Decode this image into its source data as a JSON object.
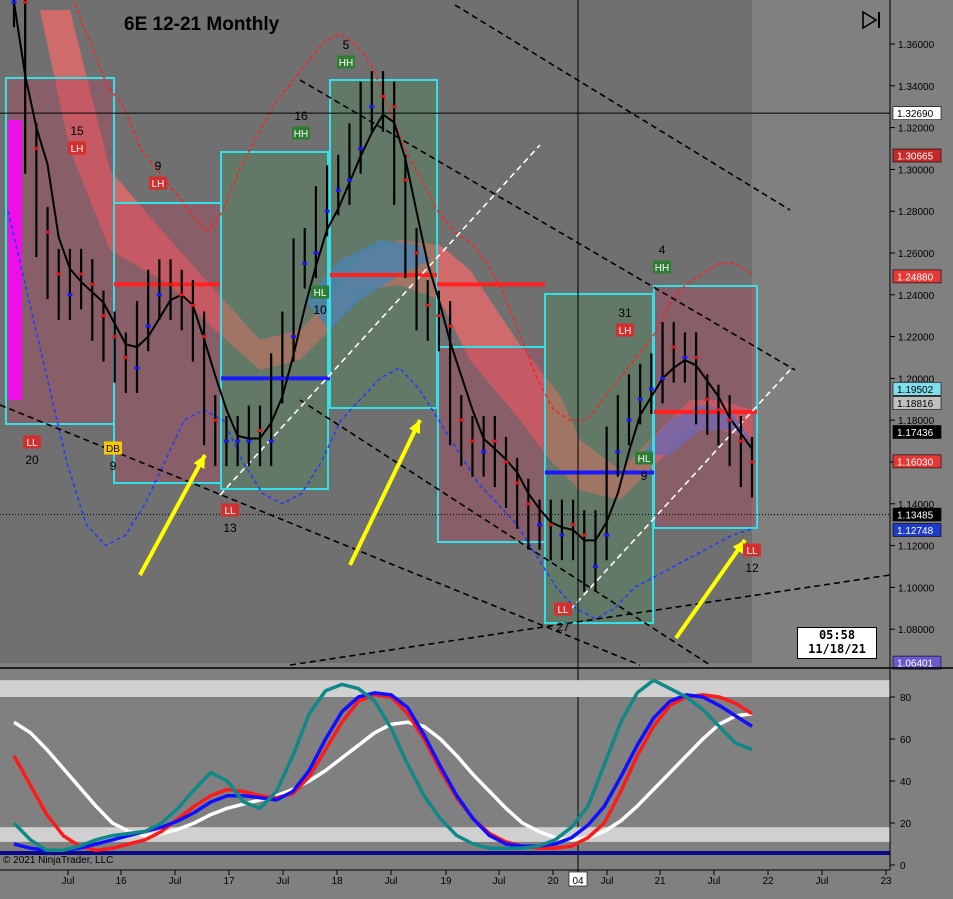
{
  "window": {
    "title": "6E 12-21 Monthly",
    "clock_time": "05:58",
    "clock_date": "11/18/21",
    "copyright": "© 2021 NinjaTrader, LLC",
    "cursor_x_label": "04"
  },
  "chart_data": [
    {
      "type": "candlestick",
      "title": "6E 12-21 Monthly",
      "ylim": [
        1.064,
        1.37
      ],
      "y_ticks": [
        1.36,
        1.34,
        1.32,
        1.3,
        1.28,
        1.26,
        1.24,
        1.22,
        1.2,
        1.18,
        1.16,
        1.14,
        1.12,
        1.1,
        1.08
      ],
      "y_tick_labels": [
        "1.36000",
        "1.34000",
        "1.32000",
        "1.30000",
        "1.28000",
        "1.26000",
        "1.24000",
        "1.22000",
        "1.20000",
        "1.18000",
        "1.16000",
        "1.14000",
        "1.12000",
        "1.10000",
        "1.08000"
      ],
      "x_tick_labels": [
        "Jul",
        "16",
        "Jul",
        "17",
        "Jul",
        "18",
        "Jul",
        "19",
        "Jul",
        "20",
        "04",
        "Jul",
        "21",
        "Jul",
        "22",
        "Jul",
        "23"
      ],
      "grid": false,
      "price_markers": [
        {
          "label": "1.32690",
          "value": 1.3269,
          "color": "#ffffff",
          "text_color": "#000000"
        },
        {
          "label": "1.30665",
          "value": 1.30665,
          "color": "#c62828",
          "text_color": "#ffffff"
        },
        {
          "label": "1.24880",
          "value": 1.2488,
          "color": "#e53935",
          "text_color": "#ffffff"
        },
        {
          "label": "1.19502",
          "value": 1.19502,
          "color": "#80deea",
          "text_color": "#000000"
        },
        {
          "label": "1.18816",
          "value": 1.18816,
          "color": "#c0c0c0",
          "text_color": "#000000"
        },
        {
          "label": "1.17436",
          "value": 1.17436,
          "color": "#000000",
          "text_color": "#ffffff"
        },
        {
          "label": "1.16030",
          "value": 1.1603,
          "color": "#e53935",
          "text_color": "#ffffff"
        },
        {
          "label": "1.13485",
          "value": 1.13485,
          "color": "#000000",
          "text_color": "#ffffff"
        },
        {
          "label": "1.12748",
          "value": 1.12748,
          "color": "#1e3cc8",
          "text_color": "#ffffff"
        },
        {
          "label": "1.06401",
          "value": 1.06401,
          "color": "#6a5acd",
          "text_color": "#ffffff"
        }
      ],
      "swing_labels": [
        {
          "tag": "LH",
          "count": "15",
          "color": "#d32f2f"
        },
        {
          "tag": "LH",
          "count": "9",
          "color": "#d32f2f"
        },
        {
          "tag": "LL",
          "count": "20",
          "color": "#d32f2f"
        },
        {
          "tag": "DB",
          "count": "9",
          "color": "#f9c800"
        },
        {
          "tag": "LL",
          "count": "13",
          "color": "#d32f2f"
        },
        {
          "tag": "HH",
          "count": "16",
          "color": "#2e7d32"
        },
        {
          "tag": "HH",
          "count": "5",
          "color": "#2e7d32"
        },
        {
          "tag": "HL",
          "count": "10",
          "color": "#2e7d32"
        },
        {
          "tag": "LL",
          "count": "27",
          "color": "#d32f2f"
        },
        {
          "tag": "LH",
          "count": "31",
          "color": "#d32f2f"
        },
        {
          "tag": "HL",
          "count": "9",
          "color": "#2e7d32"
        },
        {
          "tag": "HH",
          "count": "4",
          "color": "#2e7d32"
        },
        {
          "tag": "LL",
          "count": "12",
          "color": "#d32f2f"
        }
      ],
      "series": [
        {
          "kind": "close",
          "color": "#000000",
          "values": [
            1.38,
            1.31,
            1.27,
            1.25,
            1.24,
            1.25,
            1.245,
            1.23,
            1.22,
            1.21,
            1.205,
            1.225,
            1.24,
            1.245,
            1.24,
            1.235,
            1.22,
            1.18,
            1.17,
            1.17,
            1.17,
            1.175,
            1.17,
            1.2,
            1.22,
            1.255,
            1.26,
            1.28,
            1.29,
            1.295,
            1.31,
            1.33,
            1.335,
            1.33,
            1.295,
            1.26,
            1.235,
            1.23,
            1.225,
            1.18,
            1.17,
            1.165,
            1.17,
            1.16,
            1.15,
            1.14,
            1.13,
            1.13,
            1.125,
            1.13,
            1.125,
            1.11,
            1.125,
            1.165,
            1.18,
            1.19,
            1.195,
            1.2,
            1.215,
            1.21,
            1.21,
            1.19,
            1.185,
            1.18,
            1.17,
            1.16,
            1.155
          ]
        },
        {
          "kind": "bollinger_upper",
          "color": "#ff2020",
          "values": [
            1.47,
            1.46,
            1.44,
            1.41,
            1.38,
            1.36,
            1.34,
            1.33,
            1.31,
            1.3,
            1.29,
            1.28,
            1.27,
            1.28,
            1.3,
            1.315,
            1.33,
            1.34,
            1.35,
            1.36,
            1.365,
            1.36,
            1.35,
            1.33,
            1.31,
            1.295,
            1.28,
            1.27,
            1.265,
            1.255,
            1.24,
            1.22,
            1.2,
            1.185,
            1.18,
            1.18,
            1.19,
            1.2,
            1.21,
            1.22,
            1.235,
            1.245,
            1.25,
            1.255,
            1.255,
            1.25
          ]
        },
        {
          "kind": "bollinger_lower",
          "color": "#1e3cff",
          "values": [
            1.28,
            1.24,
            1.2,
            1.16,
            1.13,
            1.12,
            1.125,
            1.14,
            1.16,
            1.18,
            1.185,
            1.18,
            1.16,
            1.145,
            1.14,
            1.145,
            1.16,
            1.18,
            1.19,
            1.2,
            1.205,
            1.195,
            1.18,
            1.165,
            1.15,
            1.14,
            1.13,
            1.115,
            1.1,
            1.09,
            1.085,
            1.09,
            1.1,
            1.105,
            1.11,
            1.115,
            1.12,
            1.125,
            1.128
          ]
        }
      ]
    },
    {
      "type": "line",
      "title": "",
      "ylim": [
        0,
        100
      ],
      "y_ticks": [
        0,
        20,
        40,
        60,
        80
      ],
      "y_tick_labels": [
        "0",
        "20",
        "40",
        "60",
        "80"
      ],
      "bands": [
        [
          80,
          88
        ],
        [
          11,
          18
        ]
      ],
      "series": [
        {
          "color": "#ffffff",
          "values": [
            68,
            63,
            55,
            46,
            37,
            28,
            20,
            16,
            14,
            15,
            17,
            20,
            24,
            27,
            29,
            31,
            33,
            36,
            40,
            45,
            51,
            57,
            63,
            67,
            68,
            66,
            60,
            52,
            43,
            35,
            27,
            20,
            16,
            13,
            12,
            13,
            16,
            21,
            28,
            36,
            44,
            52,
            60,
            67,
            71,
            72
          ]
        },
        {
          "color": "#ff1a1a",
          "values": [
            52,
            38,
            24,
            14,
            9,
            7,
            8,
            10,
            12,
            16,
            22,
            28,
            33,
            36,
            35,
            33,
            32,
            34,
            42,
            55,
            68,
            78,
            81,
            80,
            72,
            60,
            45,
            32,
            22,
            15,
            11,
            9,
            8,
            8,
            9,
            13,
            20,
            35,
            52,
            66,
            76,
            80,
            81,
            80,
            77,
            72
          ]
        },
        {
          "color": "#1010ff",
          "values": [
            10,
            8,
            7,
            7,
            8,
            10,
            12,
            14,
            16,
            18,
            21,
            25,
            30,
            33,
            33,
            32,
            31,
            35,
            45,
            60,
            73,
            80,
            82,
            81,
            75,
            62,
            47,
            33,
            22,
            14,
            10,
            9,
            9,
            10,
            13,
            19,
            28,
            42,
            57,
            70,
            78,
            81,
            80,
            76,
            71,
            66
          ]
        },
        {
          "color": "#108888",
          "values": [
            20,
            12,
            7,
            7,
            9,
            12,
            14,
            15,
            16,
            20,
            27,
            36,
            44,
            40,
            30,
            27,
            35,
            52,
            72,
            83,
            86,
            84,
            78,
            65,
            48,
            33,
            22,
            14,
            10,
            8,
            8,
            8,
            9,
            12,
            18,
            28,
            48,
            68,
            82,
            88,
            84,
            80,
            74,
            66,
            58,
            55
          ]
        }
      ]
    }
  ]
}
